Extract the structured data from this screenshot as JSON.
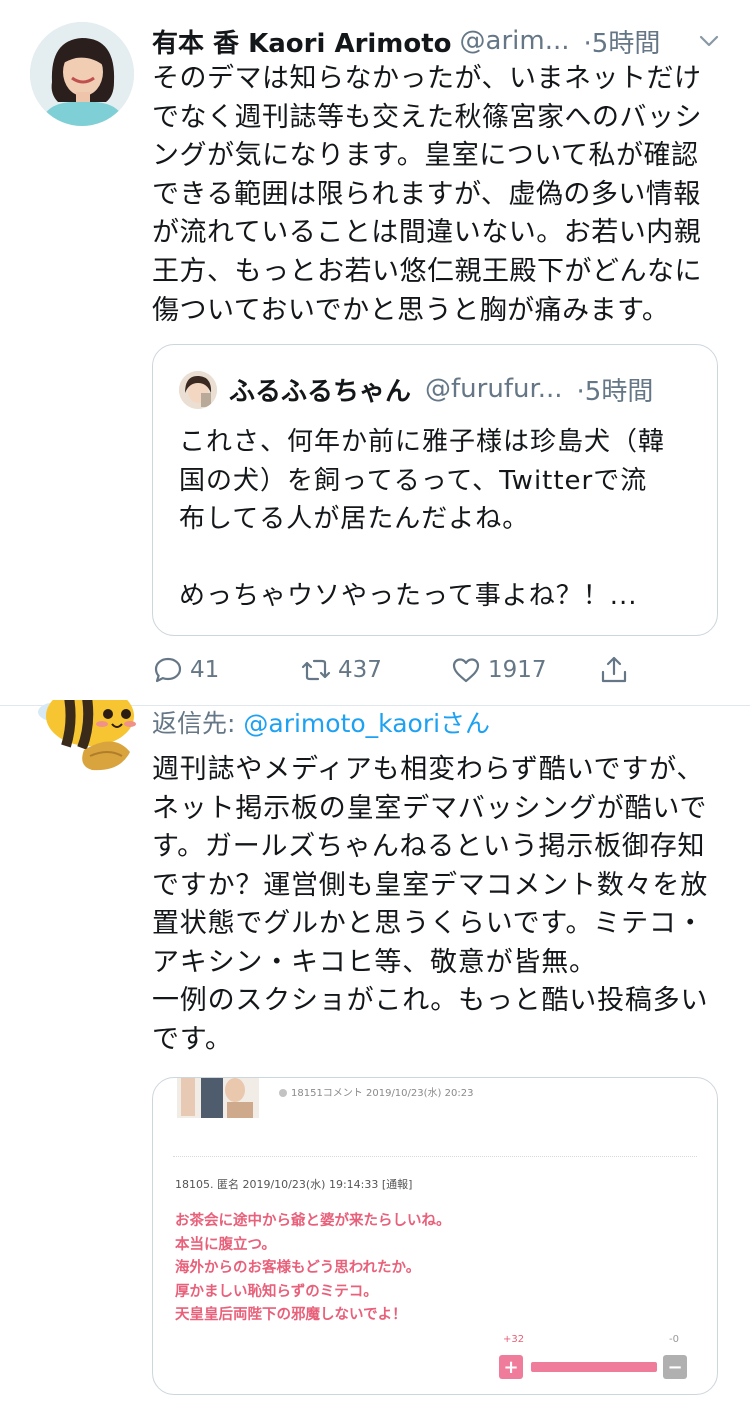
{
  "colors": {
    "text": "#14171a",
    "secondary": "#657786",
    "link": "#1da1f2",
    "border": "#ccd6dd",
    "quote_pink": "#e8607a"
  },
  "tweet": {
    "author_name": "有本  香  Kaori Arimoto",
    "author_handle": "@arim...",
    "time": "·5時間",
    "body": "そのデマは知らなかったが、いまネットだけ\nでなく週刊誌等も交えた秋篠宮家へのバッシ\nングが気になります。皇室について私が確認\nできる範囲は限られますが、虚偽の多い情報\nが流れていることは間違いない。お若い内親\n王方、もっとお若い悠仁親王殿下がどんなに\n傷ついておいでかと思うと胸が痛みます。",
    "quoted": {
      "name": "ふるふるちゃん",
      "handle": "@furufur...",
      "time": "·5時間",
      "body": "これさ、何年か前に雅子様は珍島犬（韓\n国の犬）を飼ってるって、Twitterで流\n布してる人が居たんだよね。\n\nめっちゃウソやったって事よね？！..."
    },
    "actions": {
      "replies": "41",
      "retweets": "437",
      "likes": "1917"
    },
    "icons": [
      "reply-icon",
      "retweet-icon",
      "like-icon",
      "share-icon",
      "chevron-down-icon"
    ]
  },
  "reply": {
    "reply_label": "返信先: ",
    "reply_mention": "@arimoto_kaori",
    "reply_suffix": "さん",
    "body": "週刊誌やメディアも相変わらず酷いですが、\nネット掲示板の皇室デマバッシングが酷いで\nす。ガールズちゃんねるという掲示板御存知\nですか？運営側も皇室デマコメント数々を放\n置状態でグルかと思うくらいです。ミテコ・\nアキシン・キコヒ等、敬意が皆無。\n一例のスクショがこれ。もっと酷い投稿多い\nです。",
    "screenshot": {
      "meta1": "18151コメント  2019/10/23(水) 20:23",
      "meta2": "18105. 匿名 2019/10/23(水) 19:14:33 [通報]",
      "lines": [
        "お茶会に途中から爺と婆が来たらしいね。",
        "本当に腹立つ。",
        "海外からのお客様もどう思われたか。",
        "厚かましい恥知らずのミテコ。",
        "天皇皇后両陛下の邪魔しないでよ！"
      ],
      "plus_count": "+32",
      "minus_count": "-0",
      "plus_symbol": "+",
      "minus_symbol": "−"
    }
  }
}
